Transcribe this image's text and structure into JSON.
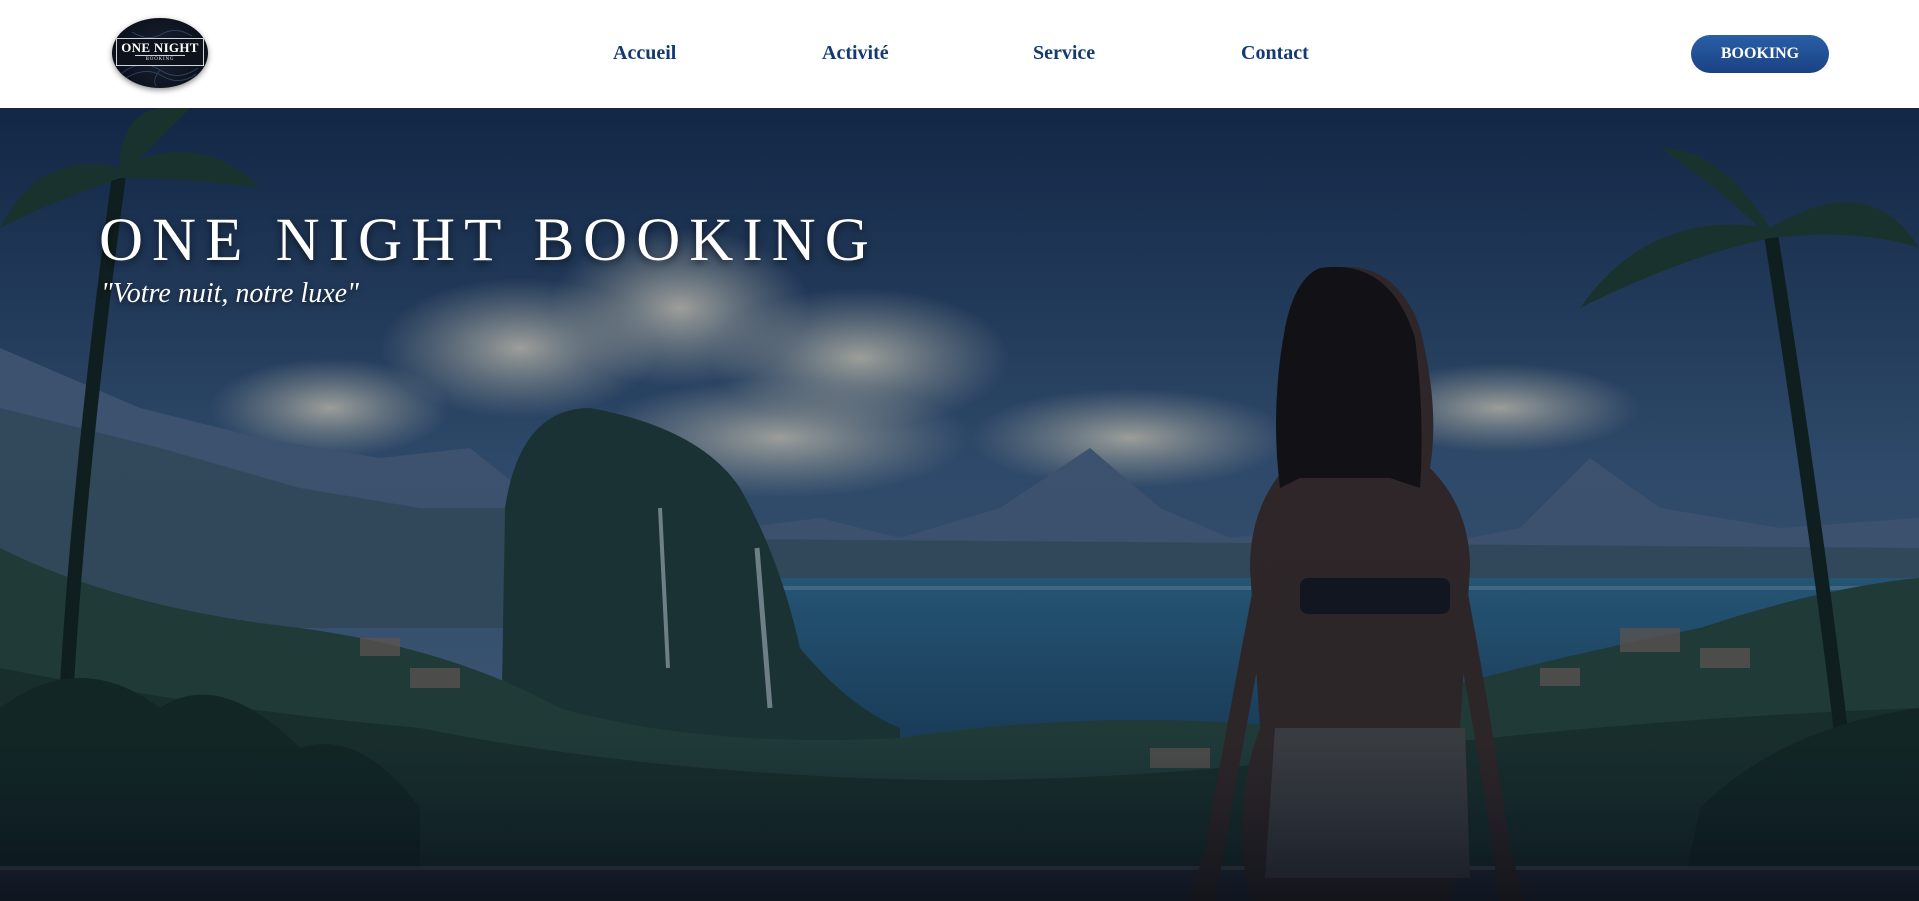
{
  "brand": {
    "logo_title": "ONE NIGHT",
    "logo_subtitle": "BOOKING"
  },
  "nav": {
    "items": [
      {
        "label": "Accueil"
      },
      {
        "label": "Activité"
      },
      {
        "label": "Service"
      },
      {
        "label": "Contact"
      }
    ],
    "cta_label": "BOOKING"
  },
  "hero": {
    "title": "ONE NIGHT BOOKING",
    "tagline": "\"Votre nuit, notre luxe\""
  },
  "colors": {
    "nav_text": "#143a74",
    "cta_bg": "#1f4b8f",
    "hero_overlay": "#13233d"
  },
  "icons": {
    "logo": "one-night-booking-logo"
  }
}
